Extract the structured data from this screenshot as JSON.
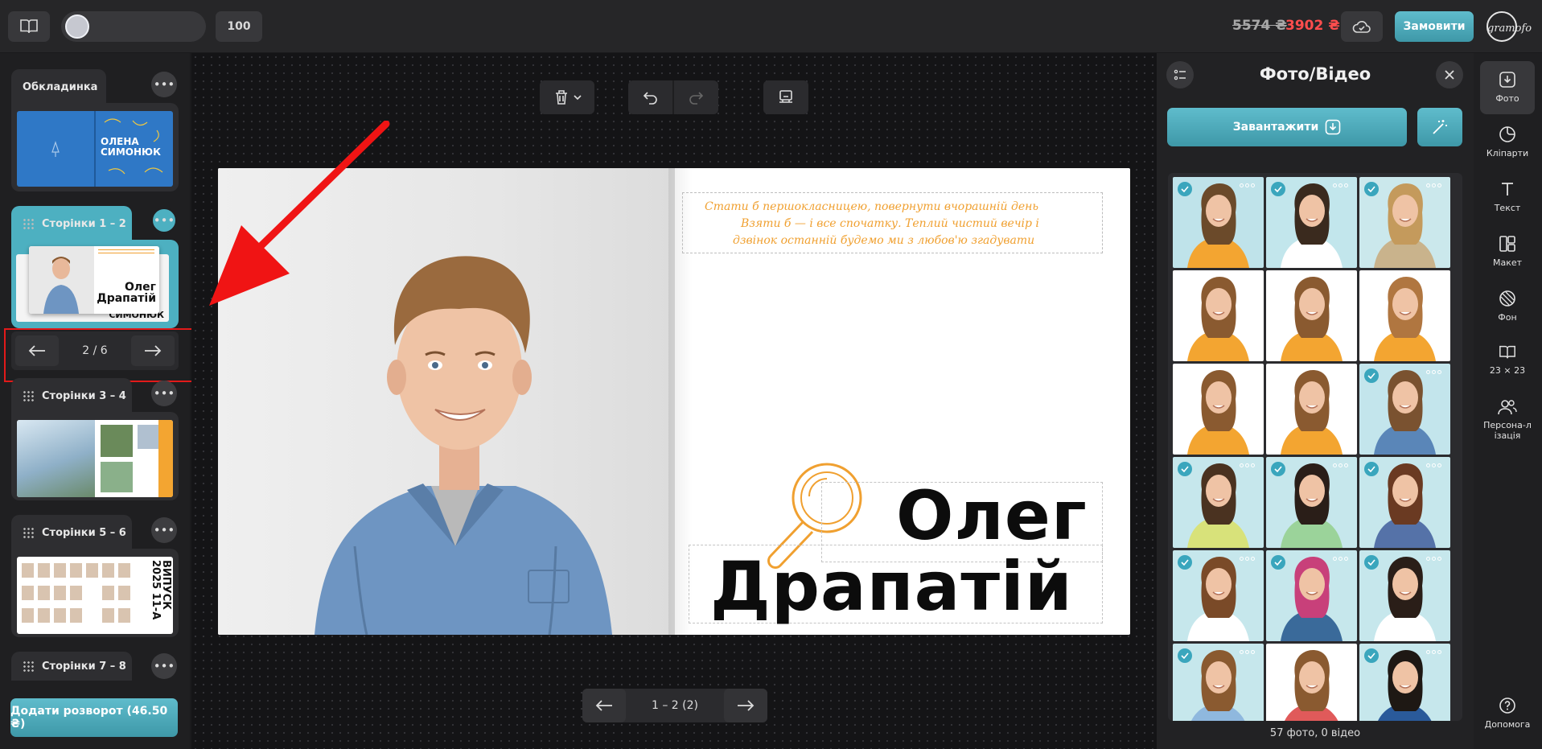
{
  "topbar": {
    "zoom": "100",
    "price_old": "5574 ₴",
    "price_new": "3902 ₴",
    "order_label": "Замовити",
    "logo_text": "gramofon",
    "accent_color": "#4db0c1",
    "price_new_color": "#ff4d4d"
  },
  "sidebar": {
    "sections": [
      {
        "label": "Обкладинка",
        "cover_name_1": "ОЛЕНА",
        "cover_name_2": "СИМОНЮК"
      },
      {
        "label": "Сторінки 1 – 2",
        "thumb_name_1": "Олег",
        "thumb_name_2": "Драпатій",
        "thumb_back": "СИМОНЮК"
      },
      {
        "label": "Сторінки 3 – 4"
      },
      {
        "label": "Сторінки 5 – 6",
        "thumb_text_1": "ВИПУСК",
        "thumb_text_2": "2025 11-А"
      },
      {
        "label": "Сторінки 7 – 8"
      }
    ],
    "pager": {
      "text": "2 / 6"
    },
    "add_spread_label": "Додати розворот (46.50 ₴)"
  },
  "canvas": {
    "script_lines": [
      "Стати б першокласницею, повернути вчорашній день",
      "Взяти б — і все спочатку. Теплий чистий вечір і",
      "дзвінок останній будемо ми з любов'ю згадувати"
    ],
    "name_first": "Олег",
    "name_last": "Драпатій",
    "pager_text": "1 – 2 (2)"
  },
  "panel": {
    "title": "Фото/Відео",
    "upload_label": "Завантажити",
    "count_text": "57 фото, 0 відео",
    "photos": [
      {
        "checked": true,
        "bg": "#bfe3ea",
        "shirt": "#f3a531",
        "hair": "#6b4a2a"
      },
      {
        "checked": true,
        "bg": "#c2e6ec",
        "shirt": "#ffffff",
        "hair": "#3a2a1e"
      },
      {
        "checked": true,
        "bg": "#cbe8ec",
        "shirt": "#c9b38c",
        "hair": "#c49a5c"
      },
      {
        "checked": false,
        "bg": "#ffffff",
        "shirt": "#f3a531",
        "hair": "#8a5a30"
      },
      {
        "checked": false,
        "bg": "#ffffff",
        "shirt": "#f3a531",
        "hair": "#8a5a30"
      },
      {
        "checked": false,
        "bg": "#ffffff",
        "shirt": "#f3a531",
        "hair": "#b07640"
      },
      {
        "checked": false,
        "bg": "#ffffff",
        "shirt": "#f3a531",
        "hair": "#8a5a30"
      },
      {
        "checked": false,
        "bg": "#ffffff",
        "shirt": "#f3a531",
        "hair": "#8a5a30"
      },
      {
        "checked": true,
        "bg": "#c3e5ec",
        "shirt": "#5a86b8",
        "hair": "#7a5230"
      },
      {
        "checked": true,
        "bg": "#c6e7ec",
        "shirt": "#d8e27a",
        "hair": "#4a3220"
      },
      {
        "checked": true,
        "bg": "#c6e7ec",
        "shirt": "#9bd39a",
        "hair": "#2a1e18"
      },
      {
        "checked": true,
        "bg": "#c6e7ec",
        "shirt": "#5572a8",
        "hair": "#6a3a22"
      },
      {
        "checked": true,
        "bg": "#c6e7ec",
        "shirt": "#ffffff",
        "hair": "#7a4a28"
      },
      {
        "checked": true,
        "bg": "#c6e7ec",
        "shirt": "#3a6a9a",
        "hair": "#c8407a"
      },
      {
        "checked": true,
        "bg": "#c6e7ec",
        "shirt": "#ffffff",
        "hair": "#2a1e18"
      },
      {
        "checked": true,
        "bg": "#c6e7ec",
        "shirt": "#8fb8de",
        "hair": "#8a5a30"
      },
      {
        "checked": false,
        "bg": "#ffffff",
        "shirt": "#e05a5a",
        "hair": "#8a5a30"
      },
      {
        "checked": true,
        "bg": "#c6e7ec",
        "shirt": "#2a5a9a",
        "hair": "#1e1814"
      }
    ]
  },
  "rail": {
    "items": [
      {
        "label": "Фото"
      },
      {
        "label": "Кліпарти"
      },
      {
        "label": "Текст"
      },
      {
        "label": "Макет"
      },
      {
        "label": "Фон"
      },
      {
        "label": "23 × 23"
      },
      {
        "label": "Персона-лізація"
      },
      {
        "label": "Допомога"
      }
    ]
  }
}
